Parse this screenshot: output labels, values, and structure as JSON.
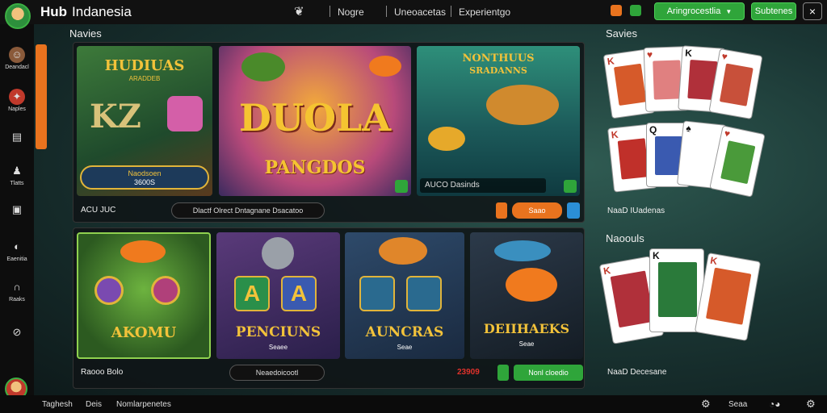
{
  "header": {
    "brand_hub": "Hub",
    "brand_region": "Indanesia",
    "nav": [
      "Nogre",
      "Uneoacetas",
      "Experientgo"
    ],
    "dropdown_label": "Aringrocestlia",
    "action_label": "Subtenes",
    "close_glyph": "×"
  },
  "sidebar": {
    "items": [
      {
        "label": "Deandacl",
        "icon": "mascot-icon"
      },
      {
        "label": "Naples",
        "icon": "flame-icon"
      },
      {
        "label": "",
        "icon": "clipboard-icon"
      },
      {
        "label": "Tlatts",
        "icon": "person-icon"
      },
      {
        "label": "",
        "icon": "document-icon"
      },
      {
        "label": "Eaenitia",
        "icon": "chat-icon"
      },
      {
        "label": "Raaks",
        "icon": "headset-icon"
      },
      {
        "label": "",
        "icon": "compass-icon"
      }
    ]
  },
  "sections": {
    "games_title": "Navies",
    "cards_top_title": "Savies",
    "cards_bottom_title": "Naoouls"
  },
  "top_row": {
    "tiles": [
      {
        "title": "HUDIUAS",
        "subtitle": "ARADDEB",
        "letters": "KZ",
        "badge_label": "Naodsoen",
        "badge_value": "3600S"
      },
      {
        "title": "DUOLA",
        "subtitle": "PANGDOS"
      },
      {
        "title": "NONTHUUS",
        "subtitle": "SRADANNS",
        "footer": "AUCO Dasinds"
      }
    ],
    "bar_left": "ACU JUC",
    "bar_search": "Dlactf Olrect Dntagnane Dsacatoo",
    "bar_button": "Saao"
  },
  "bottom_row": {
    "tiles": [
      {
        "title": "AKOMU"
      },
      {
        "title": "PENCIUNS",
        "subtitle": "Seaee"
      },
      {
        "title": "AUNCRAS",
        "subtitle": "Seae"
      },
      {
        "title": "DEIIHAEKS",
        "subtitle": "Seae"
      }
    ],
    "bar_left": "Raooo Bolo",
    "bar_search": "Neaedoicootl",
    "bar_amount": "23909",
    "bar_button": "Nonl cloedio"
  },
  "cards": {
    "top_caption": "NaaD IUadenas",
    "bottom_caption": "NaaD Decesane"
  },
  "footer": {
    "left": [
      "Taghesh",
      "Deis",
      "Nomlarpenetes"
    ],
    "right_label": "Seaa"
  },
  "colors": {
    "accent_green": "#2fa53a",
    "accent_orange": "#e9731e",
    "amount_red": "#e0322b"
  }
}
